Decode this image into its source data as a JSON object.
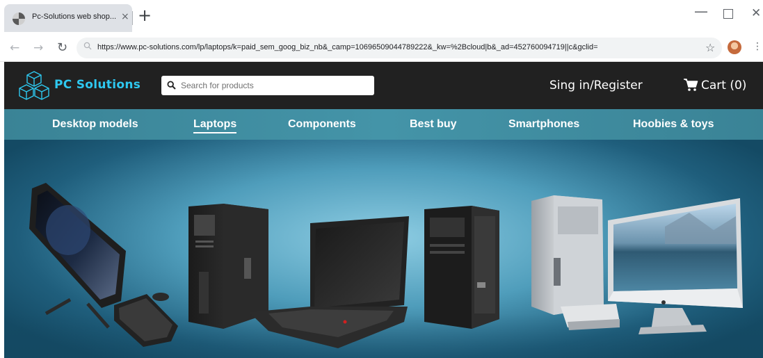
{
  "browser": {
    "tab_title": "Pc-Solutions web shop...",
    "tab_close": "×",
    "new_tab": "+",
    "url": "https://www.pc-solutions.com/lp/laptops/k=paid_sem_goog_biz_nb&_camp=10696509044789222&_kw=%2Bcloud|b&_ad=452760094719||c&gclid=",
    "icons": [
      "back-icon",
      "forward-icon",
      "reload-icon",
      "star-icon",
      "avatar",
      "menu-icon"
    ]
  },
  "header": {
    "logo_text": "PC Solutions",
    "search_placeholder": "Search for products",
    "signin_label": "Sing in/Register",
    "cart_label": "Cart (0)"
  },
  "nav": {
    "items": [
      {
        "label": "Desktop models"
      },
      {
        "label": "Laptops",
        "active": true
      },
      {
        "label": "Components"
      },
      {
        "label": "Best buy"
      },
      {
        "label": "Smartphones"
      },
      {
        "label": "Hoobies & toys"
      }
    ]
  },
  "colors": {
    "header_bg": "#212121",
    "brand_accent": "#2ec8f0",
    "nav_bg": "#4494a8"
  }
}
